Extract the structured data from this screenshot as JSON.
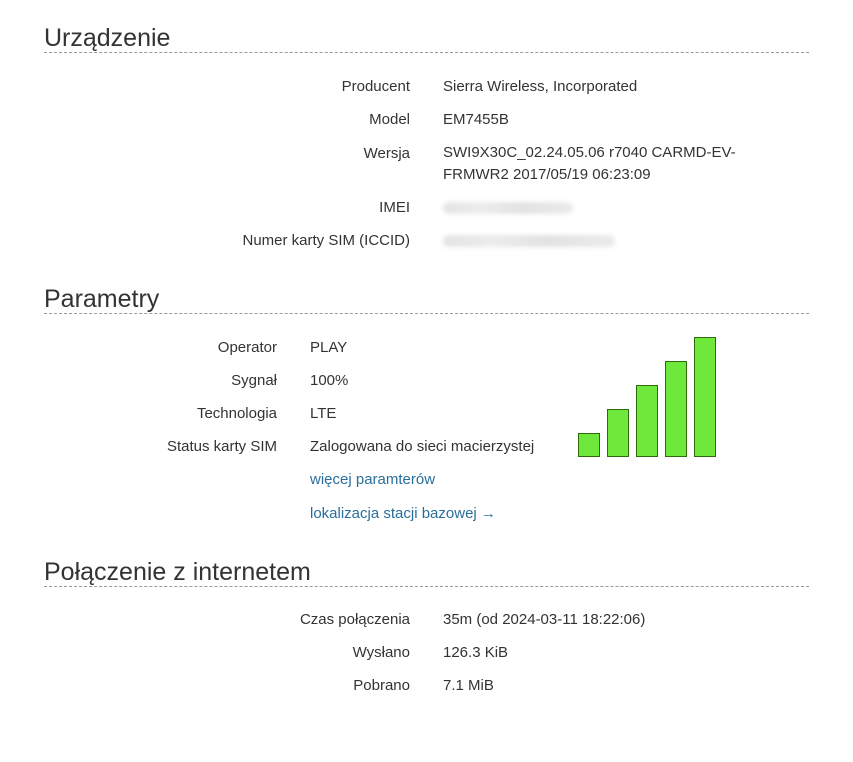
{
  "device": {
    "title": "Urządzenie",
    "rows": [
      {
        "label": "Producent",
        "value": "Sierra Wireless, Incorporated"
      },
      {
        "label": "Model",
        "value": "EM7455B"
      },
      {
        "label": "Wersja",
        "value": "SWI9X30C_02.24.05.06 r7040 CARMD-EV-FRMWR2 2017/05/19 06:23:09"
      },
      {
        "label": "IMEI",
        "value": ""
      },
      {
        "label": "Numer karty SIM (ICCID)",
        "value": ""
      }
    ]
  },
  "params": {
    "title": "Parametry",
    "rows": [
      {
        "label": "Operator",
        "value": "PLAY"
      },
      {
        "label": "Sygnał",
        "value": "100%"
      },
      {
        "label": "Technologia",
        "value": "LTE"
      },
      {
        "label": "Status karty SIM",
        "value": "Zalogowana do sieci macierzystej"
      }
    ],
    "links": {
      "more": "więcej paramterów",
      "location": "lokalizacja stacji bazowej →"
    },
    "signal": {
      "level_percent": 100,
      "bars": 5,
      "bar_color": "#6ee83a",
      "border_color": "#2f6b0c"
    }
  },
  "internet": {
    "title": "Połączenie z internetem",
    "rows": [
      {
        "label": "Czas połączenia",
        "value": "35m (od 2024-03-11 18:22:06)"
      },
      {
        "label": "Wysłano",
        "value": "126.3 KiB"
      },
      {
        "label": "Pobrano",
        "value": "7.1 MiB"
      }
    ]
  }
}
